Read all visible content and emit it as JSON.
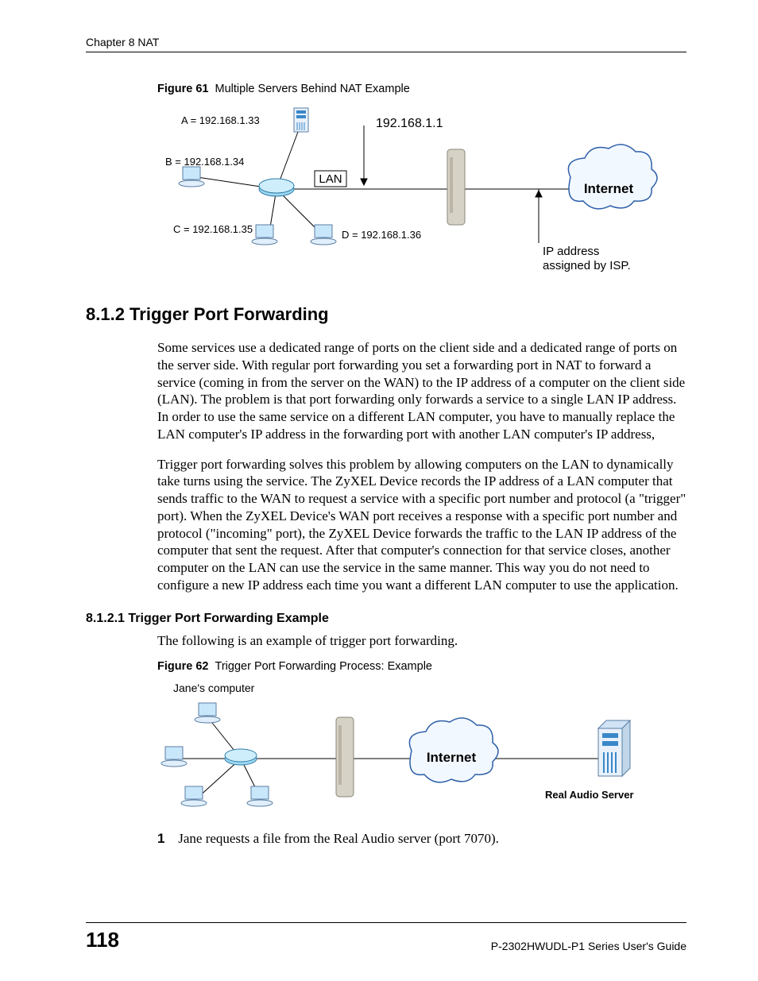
{
  "header": {
    "chapter": "Chapter 8 NAT"
  },
  "figure61": {
    "caption_label": "Figure 61",
    "caption_text": "Multiple Servers Behind NAT Example",
    "labels": {
      "a": "A = 192.168.1.33",
      "b": "B = 192.168.1.34",
      "c": "C = 192.168.1.35",
      "d": "D = 192.168.1.36",
      "gateway": "192.168.1.1",
      "lan": "LAN",
      "internet": "Internet",
      "isp1": "IP address",
      "isp2": "assigned by ISP."
    }
  },
  "section": {
    "h2": "8.1.2  Trigger Port Forwarding",
    "p1": "Some services use a dedicated range of ports on the client side and a dedicated range of ports on the server side. With regular port forwarding you set a forwarding port in NAT to forward a service (coming in from the server on the WAN) to the IP address of a computer on the client side (LAN). The problem is that port forwarding only forwards a service to a single LAN IP address. In order to use the same service on a different LAN computer, you have to manually replace the LAN computer's IP address in the forwarding port with another LAN computer's IP address,",
    "p2": "Trigger port forwarding solves this problem by allowing computers on the LAN to dynamically take turns using the service. The ZyXEL Device records the IP address of a LAN computer that sends traffic to the WAN to request a service with a specific port number and protocol (a \"trigger\" port). When the ZyXEL Device's WAN port receives a response with a specific port number and protocol (\"incoming\" port), the ZyXEL Device forwards the traffic to the LAN IP address of the computer that sent the request. After that computer's connection for that service closes, another computer on the LAN can use the service in the same manner. This way you do not need to configure a new IP address each time you want a different LAN computer to use the application.",
    "h3": "8.1.2.1  Trigger Port Forwarding Example",
    "p3": "The following is an example of trigger port forwarding."
  },
  "figure62": {
    "caption_label": "Figure 62",
    "caption_text": "Trigger Port Forwarding Process: Example",
    "labels": {
      "jane": "Jane's computer",
      "internet": "Internet",
      "server": "Real Audio Server"
    }
  },
  "steps": {
    "s1_num": "1",
    "s1_text": "Jane requests a file from the Real Audio server (port 7070)."
  },
  "footer": {
    "page": "118",
    "guide": "P-2302HWUDL-P1 Series User's Guide"
  }
}
